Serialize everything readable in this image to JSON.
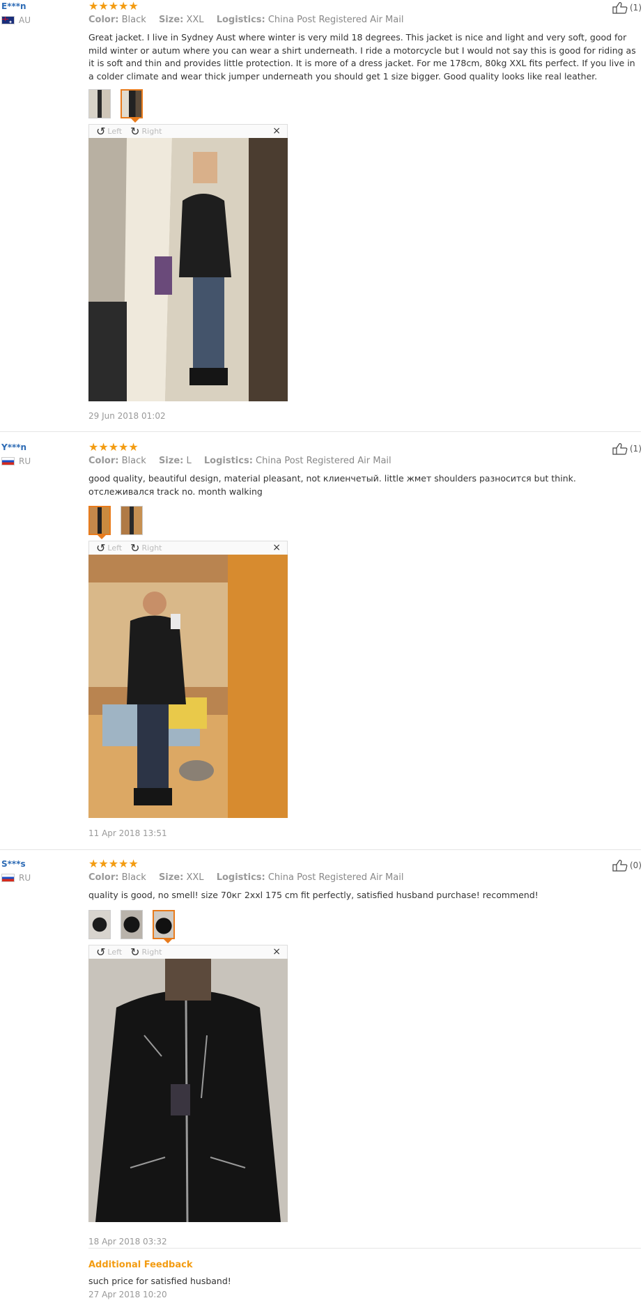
{
  "reviews": [
    {
      "user": "E***n",
      "country": "AU",
      "stars": "★★★★★",
      "color_label": "Color:",
      "color_value": "Black",
      "size_label": "Size:",
      "size_value": "XXL",
      "logistics_label": "Logistics:",
      "logistics_value": "China Post Registered Air Mail",
      "helpful_count": "(1)",
      "text": "Great jacket. I live in Sydney Aust where winter is very mild 18 degrees. This jacket is nice and light and very soft, good for mild winter or autum where you can wear a shirt underneath. I ride a motorcycle but I would not say this is good for riding as it is soft and thin and provides little protection. It is more of a dress jacket. For me 178cm, 80kg XXL fits perfect. If you live in a colder climate and wear thick jumper underneath you should get 1 size bigger. Good quality looks like real leather.",
      "viewer_left": "Left",
      "viewer_right": "Right",
      "viewer_close": "×",
      "date": "29 Jun 2018 01:02"
    },
    {
      "user": "Y***n",
      "country": "RU",
      "stars": "★★★★★",
      "color_label": "Color:",
      "color_value": "Black",
      "size_label": "Size:",
      "size_value": "L",
      "logistics_label": "Logistics:",
      "logistics_value": "China Post Registered Air Mail",
      "helpful_count": "(1)",
      "text": "good quality, beautiful design, material pleasant, not клиенчетый. little жмет shoulders разносится but think. отслеживался track no. month walking",
      "viewer_left": "Left",
      "viewer_right": "Right",
      "viewer_close": "×",
      "date": "11 Apr 2018 13:51"
    },
    {
      "user": "S***s",
      "country": "RU",
      "stars": "★★★★★",
      "color_label": "Color:",
      "color_value": "Black",
      "size_label": "Size:",
      "size_value": "XXL",
      "logistics_label": "Logistics:",
      "logistics_value": "China Post Registered Air Mail",
      "helpful_count": "(0)",
      "text": "quality is good, no smell! size 70кг 2xxl 175 cm fit perfectly, satisfied husband purchase! recommend!",
      "viewer_left": "Left",
      "viewer_right": "Right",
      "viewer_close": "×",
      "date": "18 Apr 2018 03:32",
      "additional_title": "Additional Feedback",
      "additional_text": "such price for satisfied husband!",
      "additional_date": "27 Apr 2018 10:20"
    }
  ],
  "colors": {
    "accent": "#f39c12",
    "user_link": "#2d6bb5",
    "active_thumb": "#e87b1c"
  },
  "icons": [
    "thumbs-up-icon",
    "rotate-left-icon",
    "rotate-right-icon",
    "close-icon",
    "flag-icon"
  ]
}
